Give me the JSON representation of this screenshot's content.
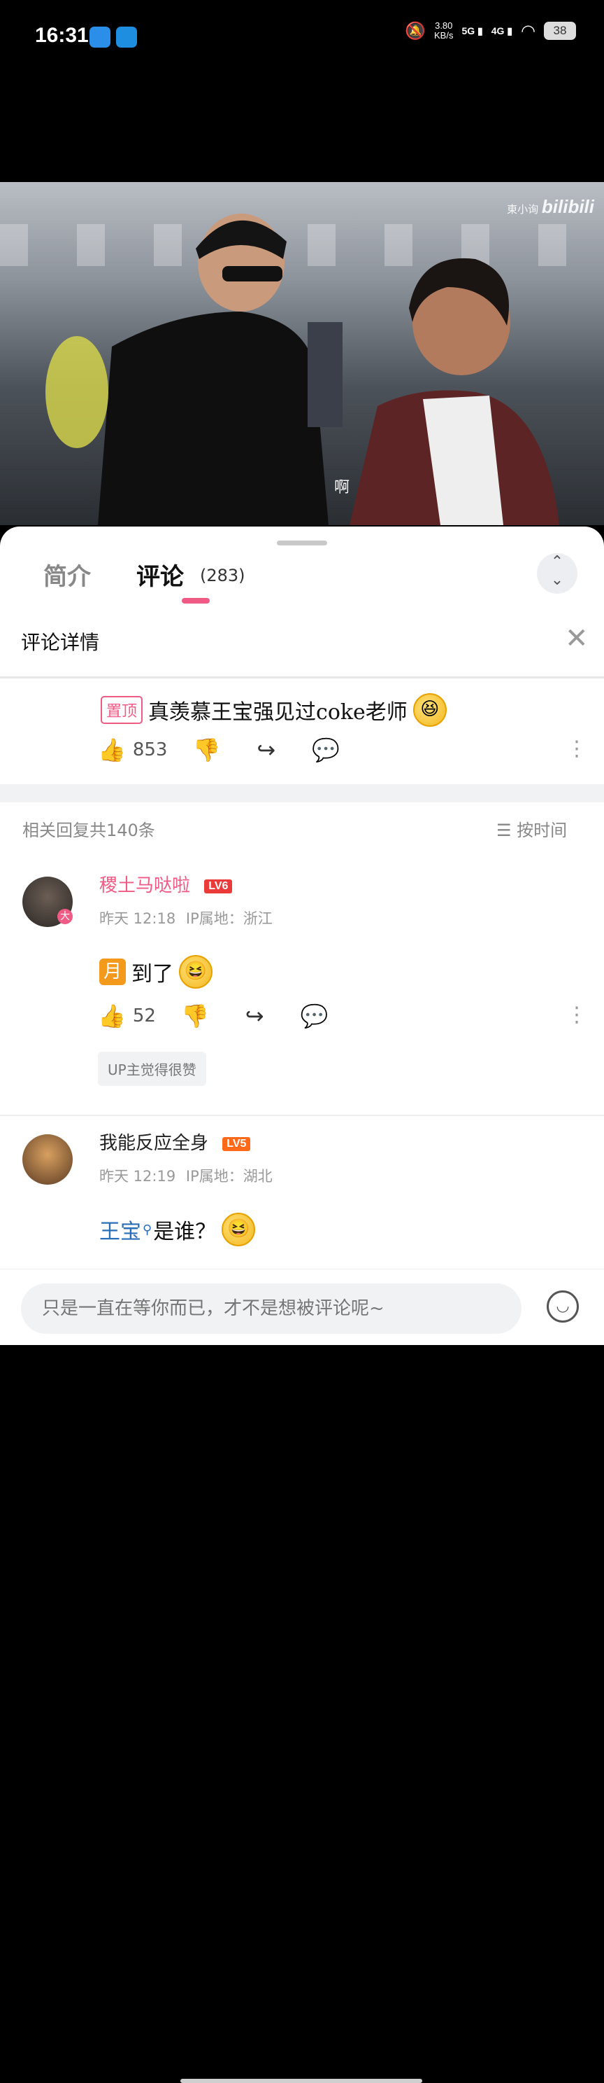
{
  "status_bar": {
    "time": "16:31",
    "speed_value": "3.80",
    "speed_unit": "KB/s",
    "net1": "5G",
    "net2": "4G",
    "battery": "38",
    "icons": [
      "telegram-icon",
      "app-icon",
      "mute-icon",
      "signal-icon",
      "wifi-icon",
      "battery-icon"
    ]
  },
  "video": {
    "watermark_author": "東小询",
    "watermark_brand": "bilibili",
    "subtitle": "啊"
  },
  "tabs": [
    {
      "label": "简介",
      "active": false
    },
    {
      "label": "评论",
      "active": true,
      "count": "(283)"
    }
  ],
  "detail": {
    "title": "评论详情"
  },
  "pinned": {
    "badge": "置顶",
    "text": "真羡慕王宝强见过coke老师",
    "likes": "853"
  },
  "replies": {
    "header": "相关回复共140条",
    "sort_label": "按时间"
  },
  "comments": [
    {
      "username": "稷土马哒啦",
      "level": "LV6",
      "time": "昨天 12:18",
      "ip": "IP属地：浙江",
      "text": "到了",
      "likes": "52",
      "up_badge": "UP主觉得很赞"
    },
    {
      "username": "我能反应全身",
      "level": "LV5",
      "time": "昨天 12:19",
      "ip": "IP属地：湖北",
      "link": "王宝",
      "text": "是谁？"
    }
  ],
  "input": {
    "placeholder": "只是一直在等你而已，才不是想被评论呢~"
  },
  "colors": {
    "accent": "#f05b86",
    "lv6": "#ea3a3a",
    "lv5": "#ff6a1a",
    "link": "#2b6fb8"
  }
}
